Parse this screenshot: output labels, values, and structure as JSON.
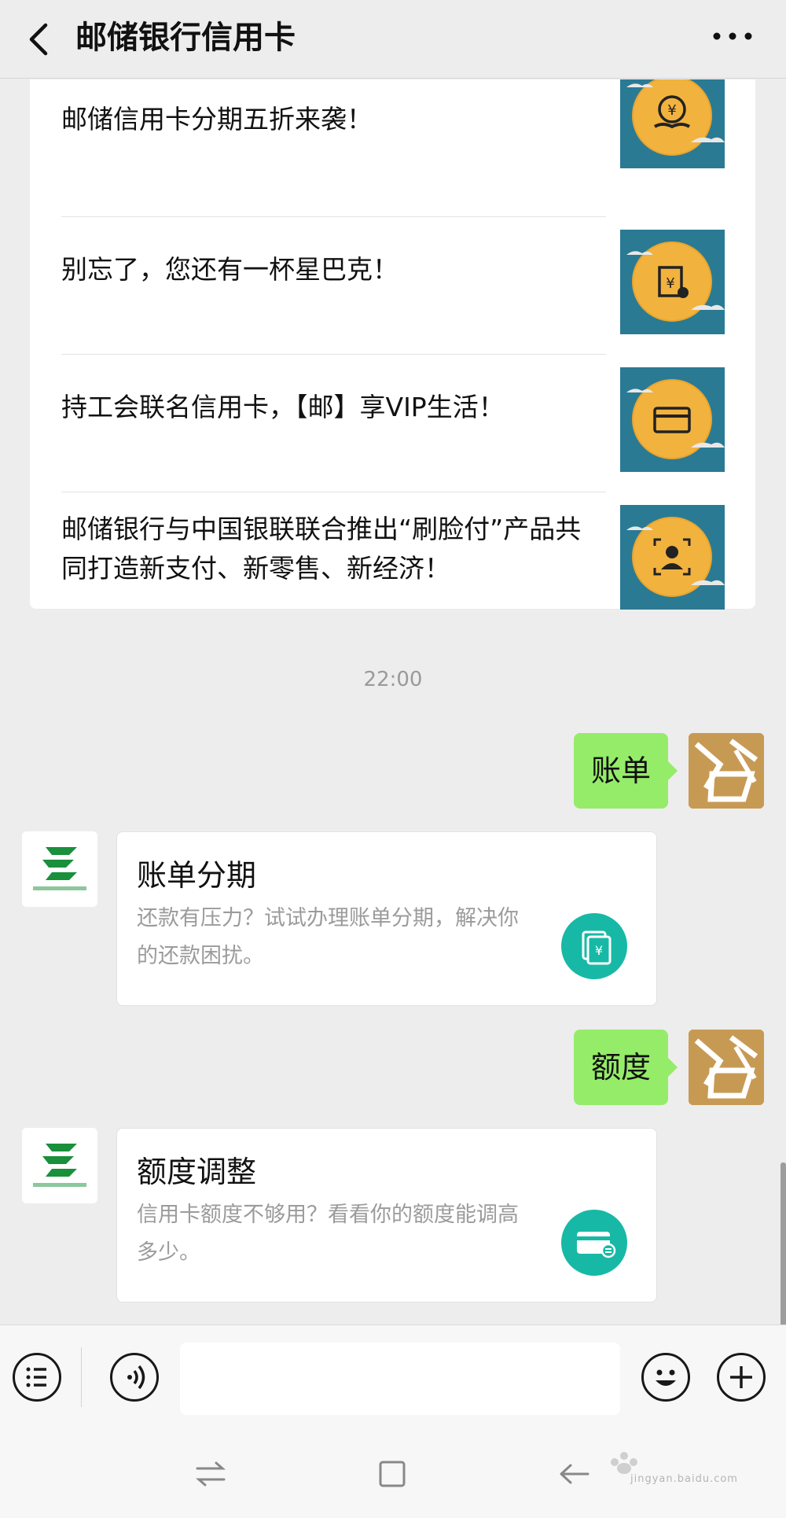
{
  "header": {
    "title": "邮储银行信用卡",
    "back_icon": "chevron-left-icon",
    "more_icon": "more-dots-icon"
  },
  "news": [
    {
      "text": "邮储信用卡分期五折来袭！",
      "icon": "yen-coin-hand-icon"
    },
    {
      "text": "别忘了，您还有一杯星巴克！",
      "icon": "gift-card-icon"
    },
    {
      "text": "持工会联名信用卡，【邮】享VIP生活！",
      "icon": "credit-card-icon"
    },
    {
      "text": "邮储银行与中国银联联合推出“刷脸付”产品共同打造新支付、新零售、新经济！",
      "icon": "face-scan-icon"
    }
  ],
  "timestamp": "22:00",
  "messages": [
    {
      "from": "user",
      "text": "账单"
    },
    {
      "from": "bank",
      "title": "账单分期",
      "desc": "还款有压力？试试办理账单分期，解决你的还款困扰。",
      "icon": "bill-yen-icon"
    },
    {
      "from": "user",
      "text": "额度"
    },
    {
      "from": "bank",
      "title": "额度调整",
      "desc": "信用卡额度不够用？看看你的额度能调高多少。",
      "icon": "card-adjust-icon"
    }
  ],
  "input_bar": {
    "menu_icon": "menu-list-icon",
    "voice_icon": "voice-icon",
    "placeholder": "",
    "emoji_icon": "emoji-icon",
    "plus_icon": "plus-icon"
  },
  "system_nav": {
    "icons": [
      "switch-arrows-icon",
      "square-home-icon",
      "back-arrow-icon"
    ],
    "watermark": "jingyan.baidu.com"
  },
  "colors": {
    "bubble_green": "#95ec69",
    "card_teal": "#17b9a6",
    "thumb_blue": "#2a7a94",
    "thumb_gold": "#f2b23e",
    "avatar_gold": "#c79a54",
    "bank_green": "#1a8f3c"
  }
}
